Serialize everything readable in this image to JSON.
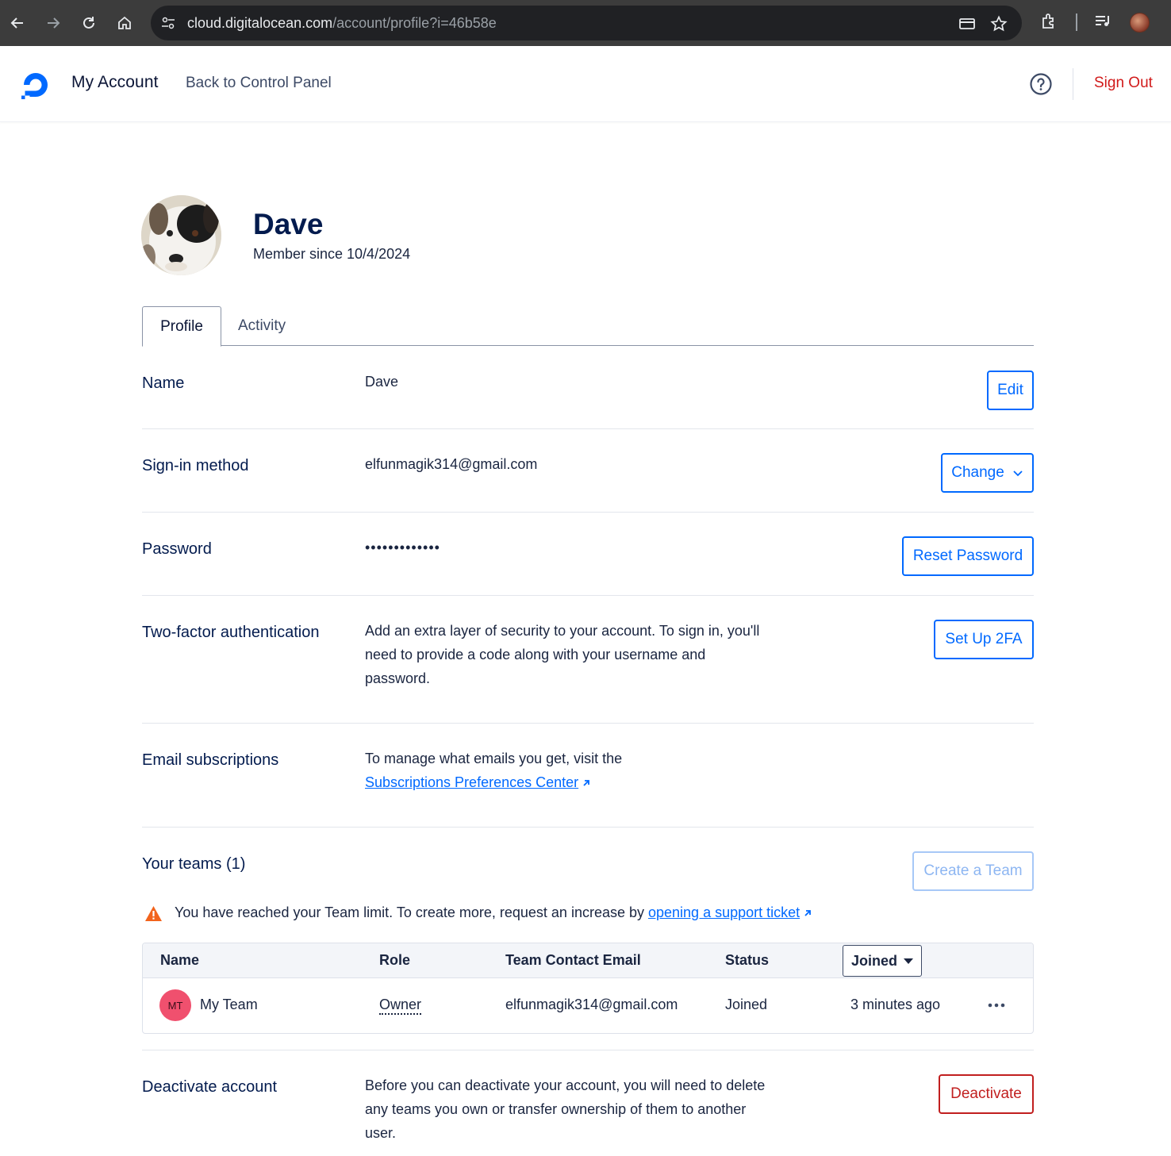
{
  "browser": {
    "url_host": "cloud.digitalocean.com",
    "url_path": "/account/profile?i=46b58e"
  },
  "header": {
    "title": "My Account",
    "back_link": "Back to Control Panel",
    "sign_out": "Sign Out"
  },
  "profile": {
    "name": "Dave",
    "member_since": "Member since 10/4/2024"
  },
  "tabs": [
    {
      "label": "Profile",
      "active": true
    },
    {
      "label": "Activity",
      "active": false
    }
  ],
  "rows": {
    "name": {
      "label": "Name",
      "value": "Dave",
      "button": "Edit"
    },
    "signin": {
      "label": "Sign-in method",
      "value": "elfunmagik314@gmail.com",
      "button": "Change"
    },
    "password": {
      "label": "Password",
      "value": "•••••••••••••",
      "button": "Reset Password"
    },
    "twofa": {
      "label": "Two-factor authentication",
      "lines": [
        "Add an extra layer of security to your account. To sign in, you'll",
        "need to provide a code along with your username and",
        "password."
      ],
      "button": "Set Up 2FA"
    },
    "email": {
      "label": "Email subscriptions",
      "text": "To manage what emails you get, visit the",
      "link": "Subscriptions Preferences Center"
    },
    "deactivate": {
      "label": "Deactivate account",
      "lines": [
        "Before you can deactivate your account, you will need to delete",
        "any teams you own or transfer ownership of them to another",
        "user."
      ],
      "button": "Deactivate"
    }
  },
  "teams": {
    "title": "Your teams (1)",
    "create_button": "Create a Team",
    "warning_text": "You have reached your Team limit. To create more, request an increase by ",
    "warning_link": "opening a support ticket",
    "columns": [
      "Name",
      "Role",
      "Team Contact Email",
      "Status"
    ],
    "sort_label": "Joined",
    "rows": [
      {
        "initials": "MT",
        "name": "My Team",
        "role": "Owner",
        "email": "elfunmagik314@gmail.com",
        "status": "Joined",
        "joined": "3 minutes ago"
      }
    ]
  },
  "colors": {
    "primary": "#0069ff",
    "danger": "#c11f1f",
    "sign_out": "#d11a1a",
    "heading": "#031b4e",
    "team_avatar": "#f0506e"
  }
}
